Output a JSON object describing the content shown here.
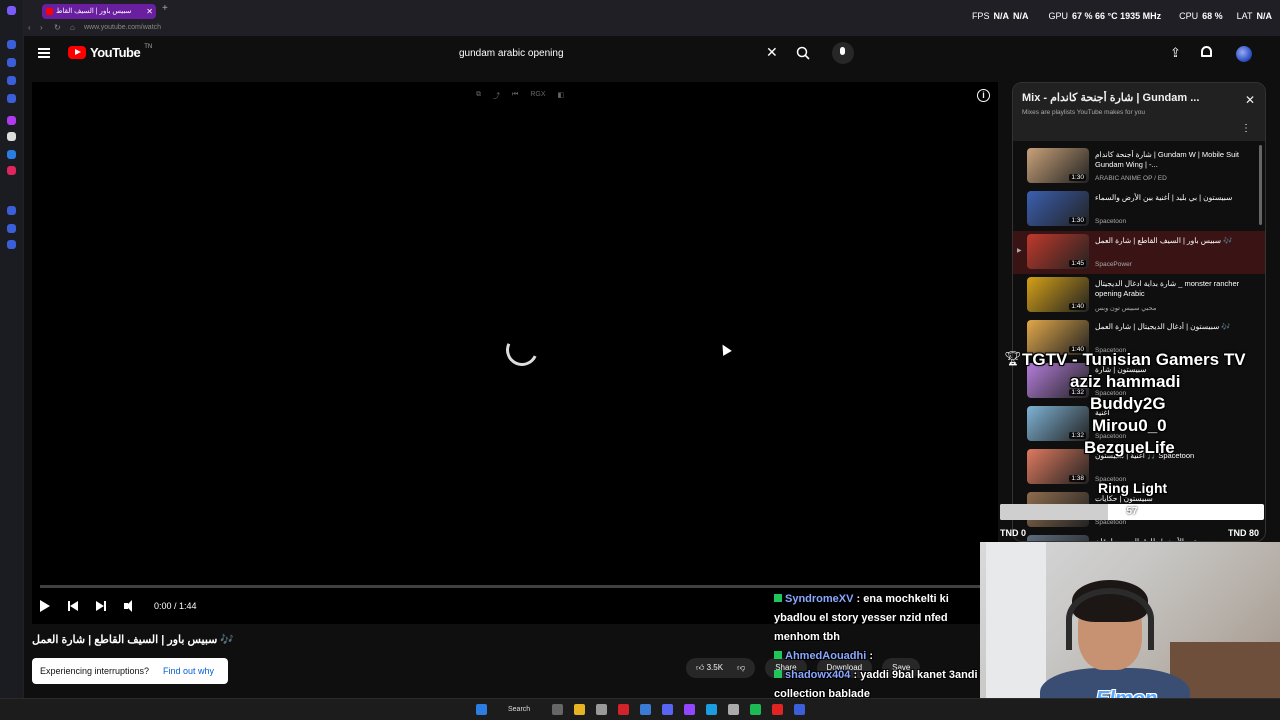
{
  "browser": {
    "tab_title": "سبيس باور | السيف القاط",
    "new_tab_glyph": "+",
    "url": "www.youtube.com/watch"
  },
  "stats": {
    "fps_label": "FPS",
    "fps_value": "N/A",
    "fps_value2": "N/A",
    "gpu_label": "GPU",
    "gpu_value": "67 %  66 °C  1935 MHz",
    "cpu_label": "CPU",
    "cpu_value": "68 %",
    "lat_label": "LAT",
    "lat_value": "N/A"
  },
  "header": {
    "logo_text": "YouTube",
    "region": "TN",
    "search_value": "gundam arabic opening",
    "clear_glyph": "✕",
    "upload_glyph": "⇪"
  },
  "player": {
    "top_tools": [
      "⧉",
      "⤴",
      "⏮",
      "RGX",
      "◧"
    ],
    "info_glyph": "i",
    "time": "0:00 / 1:44",
    "progress": 0
  },
  "video": {
    "title": "سبيس باور | السيف القاطع | شارة العمل 🎶",
    "interrupt_text": "Experiencing interruptions?",
    "interrupt_link": "Find out why",
    "likes": "3.5K",
    "share": "Share",
    "download": "Download",
    "save": "Save"
  },
  "mix": {
    "title": "Mix - شارة أجنحة كاندام | Gundam ...",
    "subtitle": "Mixes are playlists YouTube makes for you",
    "close_glyph": "✕",
    "menu_glyph": "⋮",
    "items": [
      {
        "title": "شارة أجنحة كاندام | Gundam W | Mobile Suit Gundam Wing | -...",
        "channel": "ARABIC ANIME OP / ED",
        "duration": "1:30",
        "thumb": "#c9a27a"
      },
      {
        "title": "سبيستون | بي بليد | أغنية بين الأرض والسماء",
        "channel": "Spacetoon",
        "duration": "1:30",
        "thumb": "#3b5fb0"
      },
      {
        "title": "سبيس باور | السيف القاطع | شارة العمل 🎶",
        "channel": "SpacePower",
        "duration": "1:45",
        "thumb": "#c0392b"
      },
      {
        "title": "شارة بداية ادغال الديجيتال _ monster rancher opening Arabic",
        "channel": "محبي سبيس تون وبس",
        "duration": "1:40",
        "thumb": "#d4a017"
      },
      {
        "title": "سبيستون | أدغال الديجيتال | شارة العمل 🎶",
        "channel": "Spacetoon",
        "duration": "1:40",
        "thumb": "#e2a84a"
      },
      {
        "title": "سبيستون | شارة",
        "channel": "Spacetoon",
        "duration": "1:32",
        "thumb": "#b57edc"
      },
      {
        "title": "أغنية",
        "channel": "Spacetoon",
        "duration": "1:32",
        "thumb": "#7fb3d5"
      },
      {
        "title": "أغنية | سبيستون 🎵 Spacetoon",
        "channel": "Spacetoon",
        "duration": "1:38",
        "thumb": "#e07a5f"
      },
      {
        "title": "سبيستون | حكايات",
        "channel": "Spacetoon",
        "duration": "",
        "thumb": "#8e6c4e"
      },
      {
        "title": "صقور الأرض | طارق العربي طرقان",
        "channel": "",
        "duration": "",
        "thumb": "#5d6d7e"
      }
    ]
  },
  "goal_overlay": {
    "lines": [
      "TGTV - Tunisian Gamers TV",
      "aziz hammadi",
      "Buddy2G",
      "Mirou0_0",
      "BezgueLife",
      "Ring Light"
    ],
    "count": "57",
    "progress": 0.41,
    "min_label": "TND 0",
    "max_label": "TND 80"
  },
  "chat": [
    {
      "user": "SyndromeXV",
      "text": ": ena mochkelti ki ybadlou el story yesser nzid nfed menhom tbh"
    },
    {
      "user": "AhmedAouadhi",
      "text": ":"
    },
    {
      "user": "shadowx404",
      "text": ": yaddi 9bal kanet 3andi collection bablade"
    }
  ],
  "streamer_logo": "Elmon",
  "taskbar": {
    "search_label": "Search"
  }
}
